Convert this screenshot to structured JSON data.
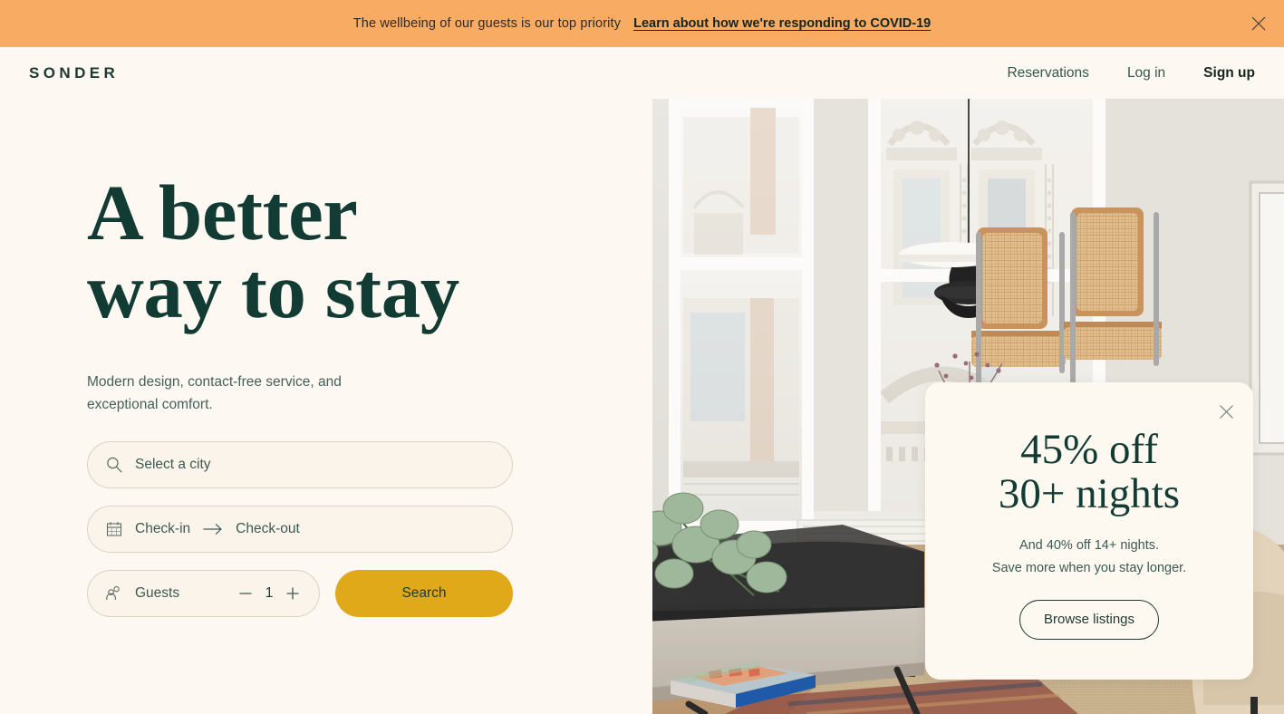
{
  "banner": {
    "message": "The wellbeing of our guests is our top priority",
    "link_label": "Learn about how we're responding to COVID-19",
    "close_icon": "close-icon",
    "background_color": "#F8AB63"
  },
  "header": {
    "logo": "SONDER",
    "nav": [
      {
        "label": "Reservations",
        "emphasis": false
      },
      {
        "label": "Log in",
        "emphasis": false
      },
      {
        "label": "Sign up",
        "emphasis": true
      }
    ]
  },
  "hero": {
    "headline": "A better\nway to stay",
    "subhead": "Modern design, contact-free service, and\nexceptional comfort.",
    "background_color": "#FDF8F2",
    "heading_color": "#123B33"
  },
  "search": {
    "city": {
      "icon": "search-icon",
      "placeholder": "Select a city"
    },
    "dates": {
      "icon": "calendar-icon",
      "checkin_placeholder": "Check-in",
      "separator_icon": "arrow-right-icon",
      "checkout_placeholder": "Check-out"
    },
    "guests": {
      "icon": "guests-icon",
      "label": "Guests",
      "decrement_icon": "minus-icon",
      "value": "1",
      "increment_icon": "plus-icon"
    },
    "submit_label": "Search",
    "submit_color": "#E0A919"
  },
  "promo": {
    "close_icon": "close-icon",
    "heading": "45% off\n30+ nights",
    "body": "And 40% off 14+ nights.\nSave more when you stay longer.",
    "cta_label": "Browse listings",
    "background_color": "#FDF8F0"
  },
  "photo": {
    "alt": "Modern apartment living room with black sofa, rattan chairs, pendant lamp and large windows"
  }
}
